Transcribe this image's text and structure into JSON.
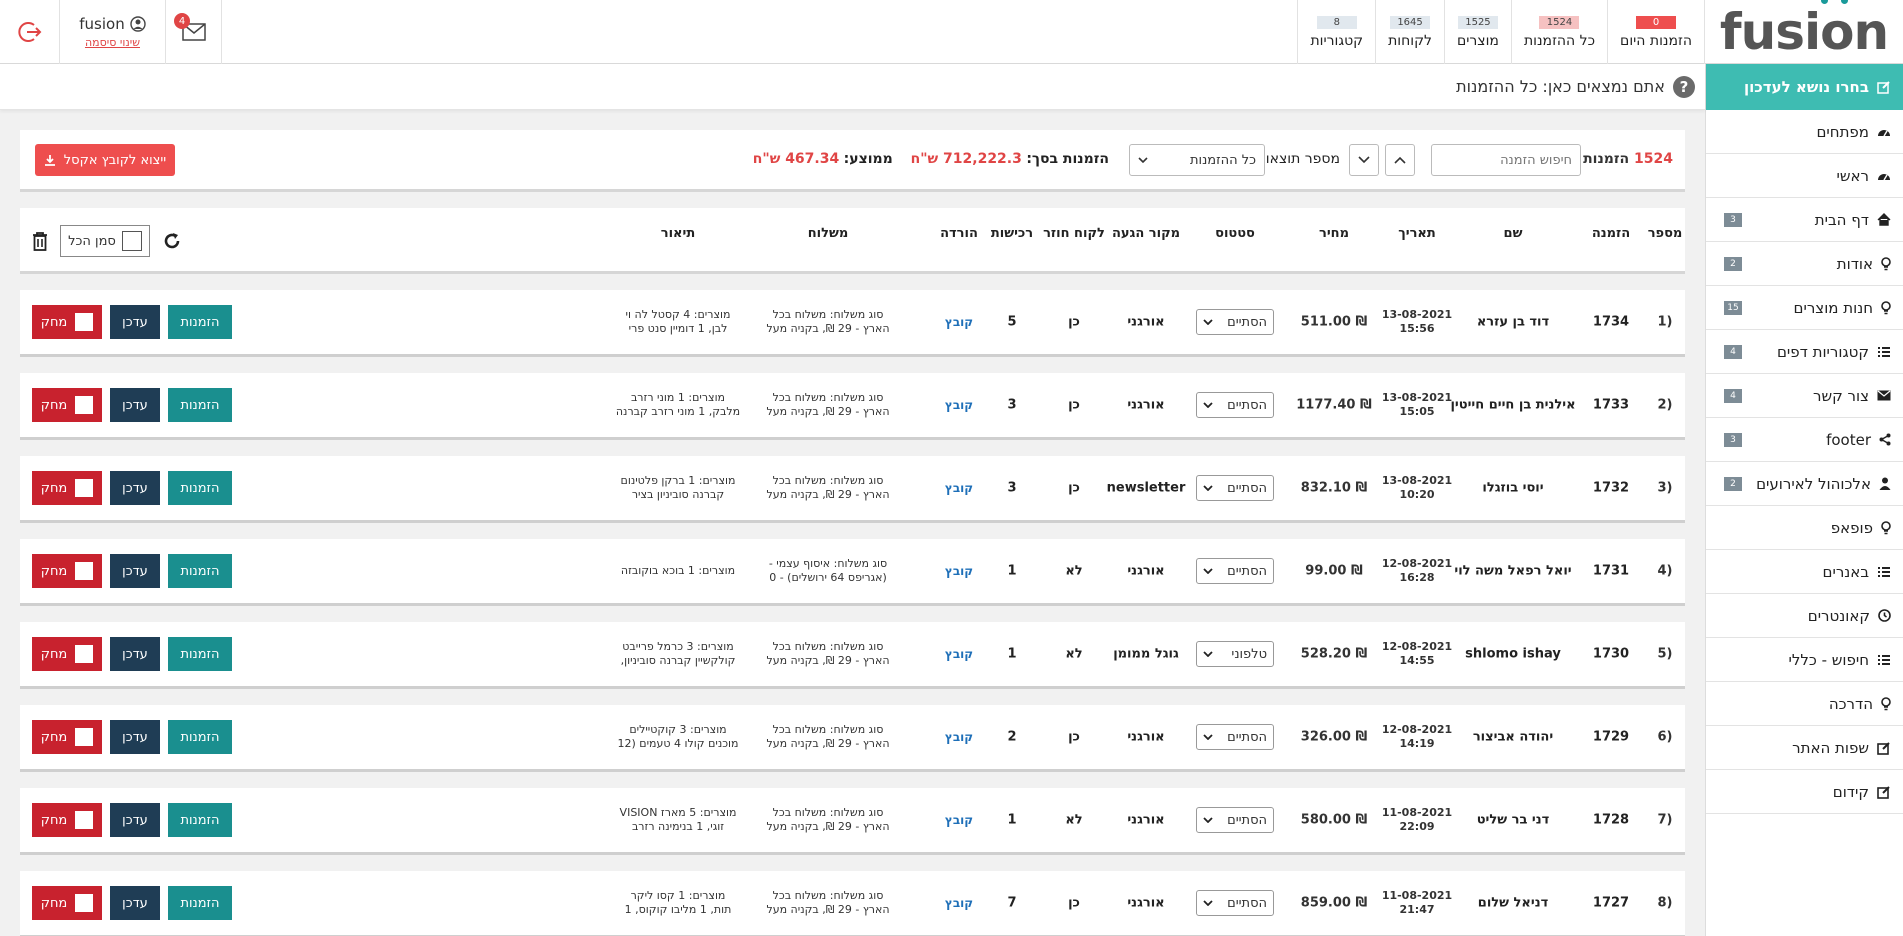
{
  "brand": {
    "logo_text": "fusion"
  },
  "topbar": {
    "stats": [
      {
        "count": "0",
        "label": "הזמנות היום",
        "style": "red"
      },
      {
        "count": "1524",
        "label": "כל ההזמנות",
        "style": "pink"
      },
      {
        "count": "1525",
        "label": "מוצרים",
        "style": "gray"
      },
      {
        "count": "1645",
        "label": "לקוחות",
        "style": "gray"
      },
      {
        "count": "8",
        "label": "קטגוריות",
        "style": "gray"
      }
    ],
    "username": "fusion",
    "change_password": "שינוי סיסמה",
    "mail_count": "4"
  },
  "sidebar": {
    "header": "בחרו נושא לעדכון",
    "items": [
      {
        "label": "מפתחים",
        "badge": "",
        "icon": "gauge-icon"
      },
      {
        "label": "ראשי",
        "badge": "",
        "icon": "gauge-icon"
      },
      {
        "label": "דף הבית",
        "badge": "3",
        "icon": "home-icon"
      },
      {
        "label": "אודות",
        "badge": "2",
        "icon": "bulb-icon"
      },
      {
        "label": "חנות מוצרים",
        "badge": "15",
        "icon": "bulb-icon"
      },
      {
        "label": "קטגוריות דפים",
        "badge": "4",
        "icon": "list-icon"
      },
      {
        "label": "צור קשר",
        "badge": "4",
        "icon": "envelope-icon"
      },
      {
        "label": "footer",
        "badge": "3",
        "icon": "share-icon"
      },
      {
        "label": "אלכוהול לאירועים",
        "badge": "2",
        "icon": "user-icon"
      },
      {
        "label": "פופאפ",
        "badge": "",
        "icon": "bulb-icon"
      },
      {
        "label": "באנרים",
        "badge": "",
        "icon": "list-icon"
      },
      {
        "label": "קאונטרים",
        "badge": "",
        "icon": "clock-icon"
      },
      {
        "label": "חיפוש - כללי",
        "badge": "",
        "icon": "list-icon"
      },
      {
        "label": "הדרכה",
        "badge": "",
        "icon": "bulb-icon"
      },
      {
        "label": "שפות האתר",
        "badge": "",
        "icon": "edit-icon"
      },
      {
        "label": "קידום",
        "badge": "",
        "icon": "edit-icon"
      }
    ]
  },
  "breadcrumb": {
    "text": "אתם נמצאים כאן: כל ההזמנות",
    "help": "?"
  },
  "filter": {
    "count_number": "1524",
    "count_label": "הזמנות",
    "search_placeholder": "חיפוש הזמנה",
    "results_label": "מספר תוצאות",
    "select_value": "כל ההזמנות",
    "total_label": "הזמנות בסך:",
    "total_value": "712,222.3 ש\"ח",
    "avg_label": "ממוצע:",
    "avg_value": "467.34 ש\"ח",
    "export_label": "ייצוא לקובץ אקסל"
  },
  "table": {
    "headers": {
      "num": "מספר",
      "order": "הזמנה",
      "name": "שם",
      "date": "תאריך",
      "price": "מחיר",
      "status": "סטטוס",
      "source": "מקור הגעה",
      "returning": "לקוח חוזר",
      "purchases": "רכישות",
      "download": "הורדה",
      "shipping": "משלוח",
      "description": "תיאור"
    },
    "select_all": "סמן הכל",
    "buttons": {
      "order": "הזמנות",
      "update": "עדכן",
      "delete": "מחק"
    },
    "rows": [
      {
        "num": "1)",
        "order": "1734",
        "name": "דוד בן עזרא",
        "date": "13-08-2021",
        "time": "15:56",
        "price": "511.00 ₪",
        "status": "הסתיים",
        "source": "אורגני",
        "returning": "כן",
        "purchases": "5",
        "download": "קובץ",
        "ship1": "סוג משלוח: משלוח בכל",
        "ship2": "הארץ - 29 ₪, בקניה מעל",
        "desc1": "מוצרים: 4 קסטל לה וי",
        "desc2": "לבן, 1 דומיין סנט פרי"
      },
      {
        "num": "2)",
        "order": "1733",
        "name": "אילנית בן חיים חייטין",
        "date": "13-08-2021",
        "time": "15:05",
        "price": "1177.40 ₪",
        "status": "הסתיים",
        "source": "אורגני",
        "returning": "כן",
        "purchases": "3",
        "download": "קובץ",
        "ship1": "סוג משלוח: משלוח בכל",
        "ship2": "הארץ - 29 ₪, בקניה מעל",
        "desc1": "מוצרים: 1 מוני רזרב",
        "desc2": "מלבק, 1 מוני רזרב קברנה"
      },
      {
        "num": "3)",
        "order": "1732",
        "name": "יוסי בוזגלו",
        "date": "13-08-2021",
        "time": "10:20",
        "price": "832.10 ₪",
        "status": "הסתיים",
        "source": "newsletter",
        "returning": "כן",
        "purchases": "3",
        "download": "קובץ",
        "ship1": "סוג משלוח: משלוח בכל",
        "ship2": "הארץ - 29 ₪, בקניה מעל",
        "desc1": "מוצרים: 1 ברקן פלטינום",
        "desc2": "קברנה סוביניון בציר"
      },
      {
        "num": "4)",
        "order": "1731",
        "name": "יואל רפאל משה לוי",
        "date": "12-08-2021",
        "time": "16:28",
        "price": "99.00 ₪",
        "status": "הסתיים",
        "source": "אורגני",
        "returning": "לא",
        "purchases": "1",
        "download": "קובץ",
        "ship1": "סוג משלוח: איסוף עצמי -",
        "ship2": "(אגריפס 64 ירושלים) - 0",
        "desc1": "מוצרים: 1 בוכא בוקובזה",
        "desc2": ""
      },
      {
        "num": "5)",
        "order": "1730",
        "name": "shlomo ishay",
        "date": "12-08-2021",
        "time": "14:55",
        "price": "528.20 ₪",
        "status": "טלפוני",
        "source": "גוגל ממומן",
        "returning": "לא",
        "purchases": "1",
        "download": "קובץ",
        "ship1": "סוג משלוח: משלוח בכל",
        "ship2": "הארץ - 29 ₪, בקניה מעל",
        "desc1": "מוצרים: 3 כרמל פרייבט",
        "desc2": "קולקשיין קברנה סוביניון,"
      },
      {
        "num": "6)",
        "order": "1729",
        "name": "יהודה אביצור",
        "date": "12-08-2021",
        "time": "14:19",
        "price": "326.00 ₪",
        "status": "הסתיים",
        "source": "אורגני",
        "returning": "כן",
        "purchases": "2",
        "download": "קובץ",
        "ship1": "סוג משלוח: משלוח בכל",
        "ship2": "הארץ - 29 ₪, בקניה מעל",
        "desc1": "מוצרים: 3 קוקטיילים",
        "desc2": "מוכנים קולו 4 טעמים (12"
      },
      {
        "num": "7)",
        "order": "1728",
        "name": "דני בר שליט",
        "date": "11-08-2021",
        "time": "22:09",
        "price": "580.00 ₪",
        "status": "הסתיים",
        "source": "אורגני",
        "returning": "לא",
        "purchases": "1",
        "download": "קובץ",
        "ship1": "סוג משלוח: משלוח בכל",
        "ship2": "הארץ - 29 ₪, בקניה מעל",
        "desc1": "מוצרים: 5 מארז VISION",
        "desc2": "זוגי, 1 בנימינה רזרב"
      },
      {
        "num": "8)",
        "order": "1727",
        "name": "דניאל שלום",
        "date": "11-08-2021",
        "time": "21:47",
        "price": "859.00 ₪",
        "status": "הסתיים",
        "source": "אורגני",
        "returning": "כן",
        "purchases": "7",
        "download": "קובץ",
        "ship1": "סוג משלוח: משלוח בכל",
        "ship2": "הארץ - 29 ₪, בקניה מעל",
        "desc1": "מוצרים: 1 קסו ליקר",
        "desc2": "תות, 1 מליבו קוקוס, 1"
      }
    ]
  },
  "colors": {
    "accent": "#3ebcb2",
    "danger": "#c8222e",
    "navy": "#1f3d55",
    "teal": "#1a8f8f",
    "link": "#1e6fb8"
  }
}
